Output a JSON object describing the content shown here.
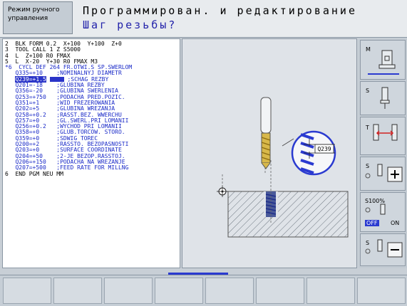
{
  "header": {
    "mode_line1": "Режим ручного",
    "mode_line2": "управления",
    "title": "Программирован. и редактирование",
    "prompt": "Шаг резьбы?"
  },
  "program": [
    {
      "text": "2  BLK FORM 0.2  X+100  Y+100  Z+0",
      "style": "normal"
    },
    {
      "text": "3  TOOL CALL 1 Z S5000",
      "style": "normal"
    },
    {
      "text": "4  L  Z+100 R0 FMAX",
      "style": "normal"
    },
    {
      "text": "5  L  X-20  Y+30 R0 FMAX M3",
      "style": "normal"
    },
    {
      "text": "*6  CYCL DEF 264 FR.OTWI.S SP.SWERLOM",
      "style": "blue"
    },
    {
      "text": "   Q335=+10    ;NOMINALNYJ DIAMETR",
      "style": "blue"
    },
    {
      "text": "   Q239=+1.5",
      "suffix": " ;SCHAG REZBY",
      "style": "cursor"
    },
    {
      "text": "   Q201=-18    ;GLUBINA REZBY",
      "style": "blue"
    },
    {
      "text": "   Q356=-20    ;GLUBINA SWERLENIA",
      "style": "blue"
    },
    {
      "text": "   Q253=+750   ;PODACHA PRED.POZIC.",
      "style": "blue"
    },
    {
      "text": "   Q351=+1     ;WID FREZEROWANIA",
      "style": "blue"
    },
    {
      "text": "   Q202=+5     ;GLUBINA WREZANJA",
      "style": "blue"
    },
    {
      "text": "   Q258=+0.2   ;RASST.BEZ. WWERCHU",
      "style": "blue"
    },
    {
      "text": "   Q257=+0     ;GL.SWERL.PRI LOMANII",
      "style": "blue"
    },
    {
      "text": "   Q256=+0.2   ;WYCHOD PRI LOMANII",
      "style": "blue"
    },
    {
      "text": "   Q358=+0     ;GLUB.TORCOW. STORO.",
      "style": "blue"
    },
    {
      "text": "   Q359=+0     ;SDWIG TOREC",
      "style": "blue"
    },
    {
      "text": "   Q200=+2     ;RASSTO. BEZOPASNOSTI",
      "style": "blue"
    },
    {
      "text": "   Q203=+0     ;SURFACE COORDINATE",
      "style": "blue"
    },
    {
      "text": "   Q204=+50    ;2-JE BEZOP.RASSTOJ.",
      "style": "blue"
    },
    {
      "text": "   Q206=+150   ;PODACHA NA WREZANJE",
      "style": "blue"
    },
    {
      "text": "   Q207=+500   ;FEED RATE FOR MILLNG",
      "style": "blue"
    },
    {
      "text": "6  END PGM NEU MM",
      "style": "normal"
    }
  ],
  "graphic": {
    "param_label": "Q239"
  },
  "softkeys_right": {
    "m_label": "M",
    "s_label": "S",
    "t_label": "T",
    "s_plus_label": "S",
    "override_label": "S100%",
    "off_label": "OFF",
    "on_label": "ON",
    "s_minus_label": "S"
  },
  "colors": {
    "accent_blue": "#2a34c8",
    "program_text_blue": "#1a2ac8",
    "background": "#c8cfd6"
  }
}
